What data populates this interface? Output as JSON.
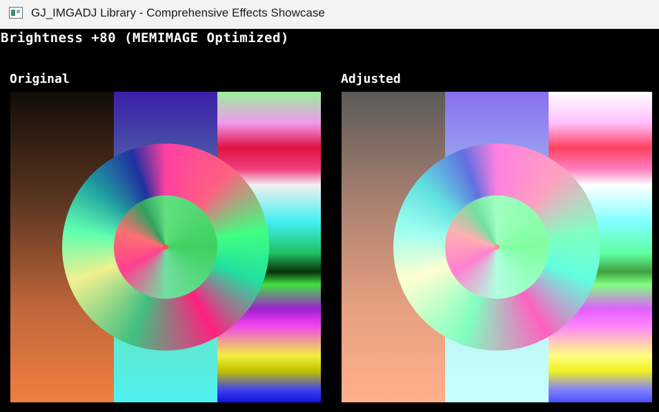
{
  "window": {
    "title": "GJ_IMGADJ Library - Comprehensive Effects Showcase",
    "icon": "app-window-icon"
  },
  "canvas": {
    "heading": "Brightness +80 (MEMIMAGE Optimized)",
    "panels": [
      {
        "label": "Original"
      },
      {
        "label": "Adjusted"
      }
    ]
  },
  "colors": {
    "titlebar_bg": "#f3f3f3",
    "canvas_bg": "#000000",
    "text": "#ffffff"
  }
}
